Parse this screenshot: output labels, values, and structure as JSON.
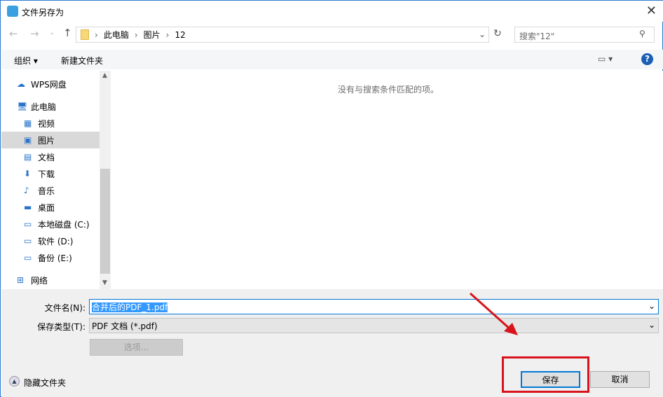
{
  "title": "文件另存为",
  "breadcrumb": [
    "此电脑",
    "图片",
    "12"
  ],
  "search_placeholder": "搜索\"12\"",
  "toolbar": {
    "organize": "组织 ▾",
    "new_folder": "新建文件夹"
  },
  "sidebar": [
    {
      "label": "WPS网盘",
      "icon": "cloud-icon"
    },
    {
      "label": "此电脑",
      "icon": "computer-icon"
    },
    {
      "label": "视频",
      "icon": "video-icon"
    },
    {
      "label": "图片",
      "icon": "picture-icon",
      "selected": true
    },
    {
      "label": "文档",
      "icon": "document-icon"
    },
    {
      "label": "下载",
      "icon": "download-icon"
    },
    {
      "label": "音乐",
      "icon": "music-icon"
    },
    {
      "label": "桌面",
      "icon": "desktop-icon"
    },
    {
      "label": "本地磁盘 (C:)",
      "icon": "drive-icon"
    },
    {
      "label": "软件 (D:)",
      "icon": "drive-icon"
    },
    {
      "label": "备份 (E:)",
      "icon": "drive-icon"
    },
    {
      "label": "网络",
      "icon": "network-icon"
    }
  ],
  "empty_message": "没有与搜索条件匹配的项。",
  "filename_label": "文件名(N):",
  "filename_value": "合并后的PDF_1.pdf",
  "filetype_label": "保存类型(T):",
  "filetype_value": "PDF 文档 (*.pdf)",
  "options_label": "选项...",
  "hide_folders": "隐藏文件夹",
  "save": "保存",
  "cancel": "取消"
}
